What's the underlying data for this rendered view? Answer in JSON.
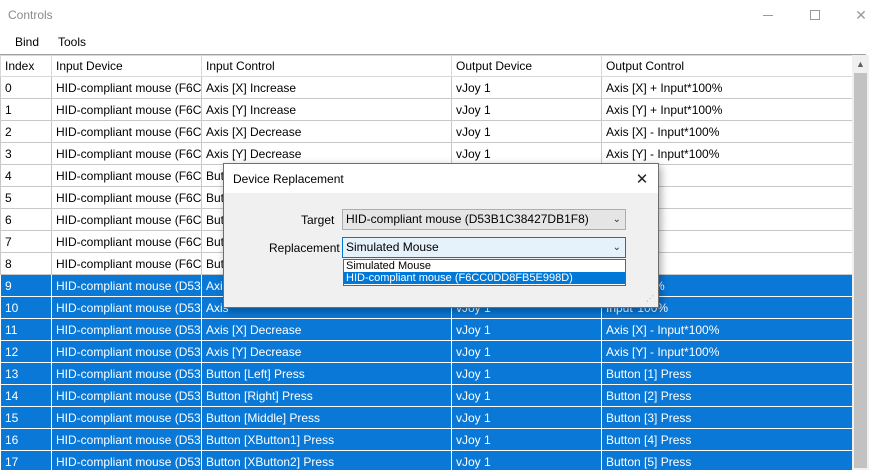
{
  "window": {
    "title": "Controls"
  },
  "menu": {
    "items": [
      "Bind",
      "Tools"
    ]
  },
  "table": {
    "columns": [
      "Index",
      "Input Device",
      "Input Control",
      "Output Device",
      "Output Control"
    ],
    "rows": [
      [
        "0",
        "HID-compliant mouse (F6CC...",
        "Axis [X] Increase",
        "vJoy 1",
        "Axis [X] + Input*100%"
      ],
      [
        "1",
        "HID-compliant mouse (F6CC...",
        "Axis [Y] Increase",
        "vJoy 1",
        "Axis [Y] + Input*100%"
      ],
      [
        "2",
        "HID-compliant mouse (F6CC...",
        "Axis [X] Decrease",
        "vJoy 1",
        "Axis [X] - Input*100%"
      ],
      [
        "3",
        "HID-compliant mouse (F6CC...",
        "Axis [Y] Decrease",
        "vJoy 1",
        "Axis [Y] - Input*100%"
      ],
      [
        "4",
        "HID-compliant mouse (F6CC...",
        "Butt",
        "",
        "Press"
      ],
      [
        "5",
        "HID-compliant mouse (F6CC...",
        "Butt",
        "",
        "Press"
      ],
      [
        "6",
        "HID-compliant mouse (F6CC...",
        "Butt",
        "",
        "Press"
      ],
      [
        "7",
        "HID-compliant mouse (F6CC...",
        "Butt",
        "",
        "Press"
      ],
      [
        "8",
        "HID-compliant mouse (F6CC...",
        "Butt",
        "",
        "Press"
      ],
      [
        "9",
        "HID-compliant mouse (D53...",
        "Axis",
        "",
        "nput*100%"
      ],
      [
        "10",
        "HID-compliant mouse (D53...",
        "Axis",
        "vJoy 1",
        "Input*100%"
      ],
      [
        "11",
        "HID-compliant mouse (D53...",
        "Axis [X] Decrease",
        "vJoy 1",
        "Axis [X] - Input*100%"
      ],
      [
        "12",
        "HID-compliant mouse (D53...",
        "Axis [Y] Decrease",
        "vJoy 1",
        "Axis [Y] - Input*100%"
      ],
      [
        "13",
        "HID-compliant mouse (D53...",
        "Button [Left] Press",
        "vJoy 1",
        "Button [1] Press"
      ],
      [
        "14",
        "HID-compliant mouse (D53...",
        "Button [Right] Press",
        "vJoy 1",
        "Button [2] Press"
      ],
      [
        "15",
        "HID-compliant mouse (D53...",
        "Button [Middle] Press",
        "vJoy 1",
        "Button [3] Press"
      ],
      [
        "16",
        "HID-compliant mouse (D53...",
        "Button [XButton1] Press",
        "vJoy 1",
        "Button [4] Press"
      ],
      [
        "17",
        "HID-compliant mouse (D53...",
        "Button [XButton2] Press",
        "vJoy 1",
        "Button [5] Press"
      ]
    ],
    "selected_rows": [
      9,
      10,
      11,
      12,
      13,
      14,
      15,
      16,
      17
    ]
  },
  "dialog": {
    "title": "Device Replacement",
    "target_label": "Target",
    "target_value": "HID-compliant mouse (D53B1C38427DB1F8)",
    "replacement_label": "Replacement",
    "replacement_value": "Simulated Mouse",
    "options": [
      "Simulated Mouse",
      "HID-compliant mouse (F6CC0DD8FB5E998D)"
    ],
    "highlighted_option": 1
  },
  "colors": {
    "selection": "#0a78d7",
    "dropdown_highlight": "#0078d7"
  },
  "icons": {
    "minimize": "minimize-icon",
    "maximize": "maximize-icon",
    "close": "close-icon",
    "dropdown": "chevron-down-icon"
  }
}
